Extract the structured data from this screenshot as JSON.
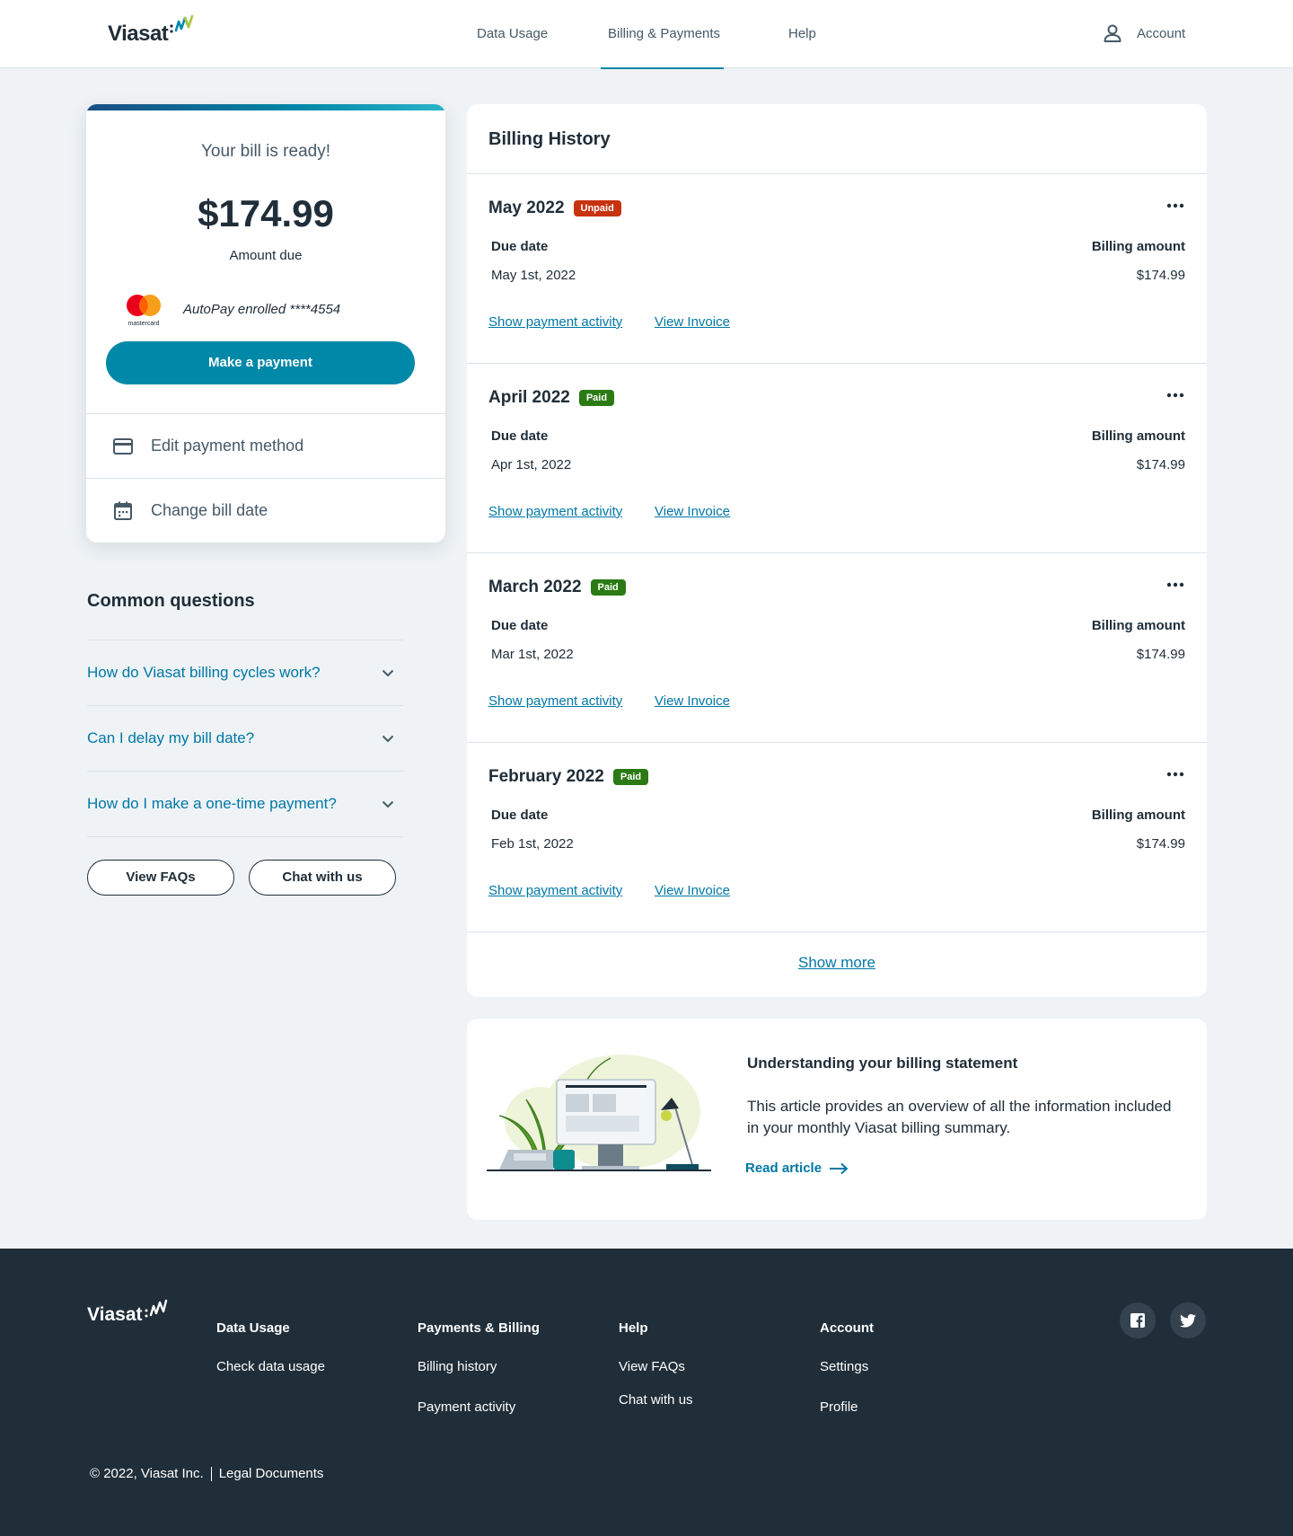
{
  "header": {
    "logo_text": "Viasat",
    "nav": [
      {
        "label": "Data Usage",
        "active": false
      },
      {
        "label": "Billing  & Payments",
        "active": true
      },
      {
        "label": "Help",
        "active": false
      }
    ],
    "account_label": "Account"
  },
  "bill_card": {
    "title": "Your bill is ready!",
    "amount": "$174.99",
    "amount_label": "Amount due",
    "card_brand_label": "mastercard",
    "autopay_text": "AutoPay enrolled ****4554",
    "pay_button": "Make a payment",
    "edit_payment": "Edit payment method",
    "change_bill_date": "Change bill date"
  },
  "common_questions": {
    "title": "Common questions",
    "items": [
      "How do Viasat billing cycles work?",
      "Can I delay my bill date?",
      "How do I make a one-time payment?"
    ],
    "view_faqs": "View FAQs",
    "chat": "Chat with us"
  },
  "billing_history": {
    "title": "Billing History",
    "due_label": "Due date",
    "amount_label": "Billing amount",
    "show_activity": "Show payment activity",
    "view_invoice": "View Invoice",
    "items": [
      {
        "month": "May 2022",
        "status": "Unpaid",
        "due": "May 1st, 2022",
        "amount": "$174.99"
      },
      {
        "month": "April 2022",
        "status": "Paid",
        "due": "Apr 1st, 2022",
        "amount": "$174.99"
      },
      {
        "month": "March 2022",
        "status": "Paid",
        "due": "Mar 1st, 2022",
        "amount": "$174.99"
      },
      {
        "month": "February 2022",
        "status": "Paid",
        "due": "Feb 1st, 2022",
        "amount": "$174.99"
      }
    ],
    "show_more": "Show more"
  },
  "article": {
    "title": "Understanding your billing statement",
    "body": "This article provides an overview of all the information included in your monthly Viasat billing summary.",
    "link": "Read article"
  },
  "footer": {
    "logo_text": "Viasat",
    "columns": [
      {
        "head": "Data Usage",
        "links": [
          "Check data usage"
        ]
      },
      {
        "head": "Payments & Billing",
        "links": [
          "Billing history",
          "Payment activity"
        ]
      },
      {
        "head": "Help",
        "links": [
          "View FAQs",
          "Chat with us"
        ]
      },
      {
        "head": "Account",
        "links": [
          "Settings",
          "Profile"
        ]
      }
    ],
    "copyright": "© 2022, Viasat Inc.",
    "legal": "Legal Documents"
  },
  "colors": {
    "brand_teal": "#0088A9",
    "link_blue": "#0077A6",
    "unpaid_red": "#C8330F",
    "paid_green": "#2B7A14",
    "footer_bg": "#202E39"
  },
  "icons": [
    "user-icon",
    "mastercard-icon",
    "credit-card-icon",
    "calendar-icon",
    "chevron-down-icon",
    "more-dots-icon",
    "arrow-right-icon",
    "facebook-icon",
    "twitter-icon"
  ]
}
